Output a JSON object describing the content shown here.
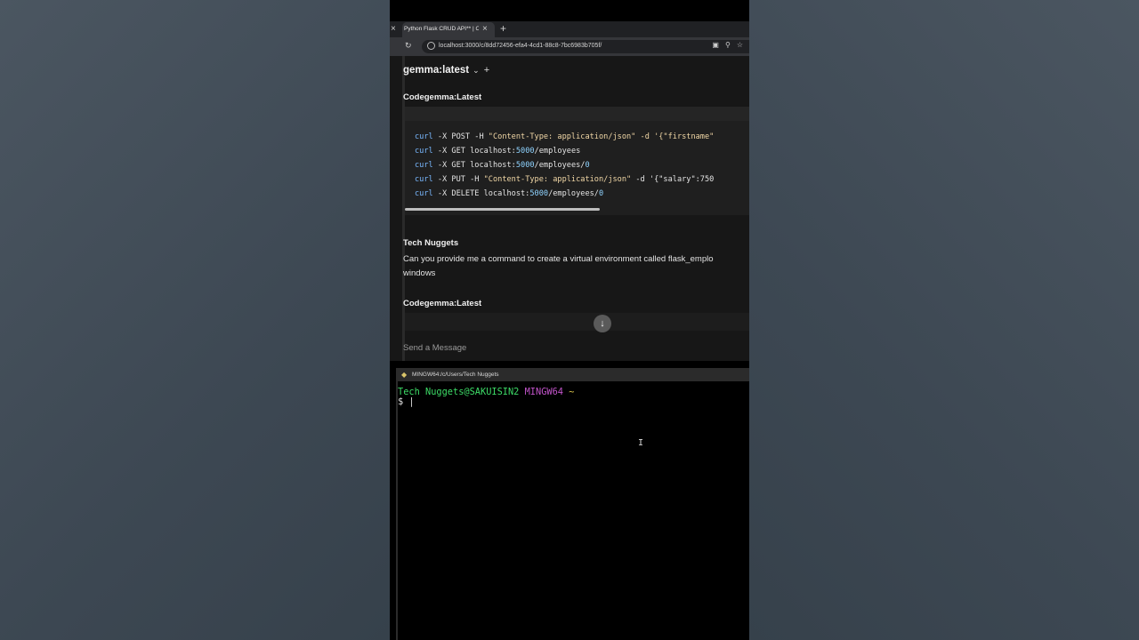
{
  "browser": {
    "tab_title": "Python Flask CRUD API** | O:",
    "tab_close": "×",
    "new_tab": "+",
    "url": "localhost:3000/c/8dd72456-efa4-4cd1-88c8-7bc6983b705f/"
  },
  "chat": {
    "model_name": "gemma:latest",
    "model_chevron": "⌄",
    "add_model": "+",
    "reply_sender_1": "Codegemma:Latest",
    "code_lines": [
      {
        "cmd": "curl",
        "rest": " -X POST -H ",
        "str": "\"Content-Type: application/json\"",
        "tail": " -d '{\"firstname\""
      },
      {
        "cmd": "curl",
        "rest": " -X GET localhost:",
        "num": "5000",
        "tail": "/employees"
      },
      {
        "cmd": "curl",
        "rest": " -X GET localhost:",
        "num": "5000",
        "tail": "/employees/",
        "num2": "0"
      },
      {
        "cmd": "curl",
        "rest": " -X PUT -H ",
        "str": "\"Content-Type: application/json\"",
        "tail": " -d '{\"salary\":750"
      },
      {
        "cmd": "curl",
        "rest": " -X DELETE localhost:",
        "num": "5000",
        "tail": "/employees/",
        "num2": "0"
      }
    ],
    "user_sender": "Tech Nuggets",
    "user_message_line1": "Can you provide me a command to create a virtual environment called flask_emplo",
    "user_message_line2": "windows",
    "reply_sender_2": "Codegemma:Latest",
    "scroll_down_icon": "↓",
    "input_placeholder": "Send a Message"
  },
  "terminal": {
    "title": "MINGW64:/c/Users/Tech Nuggets",
    "prompt_user": "Tech Nuggets@SAKUISIN2",
    "prompt_env": "MINGW64",
    "prompt_path": "~",
    "prompt_symbol": "$",
    "cursor": "|",
    "mouse_cursor": "I"
  }
}
